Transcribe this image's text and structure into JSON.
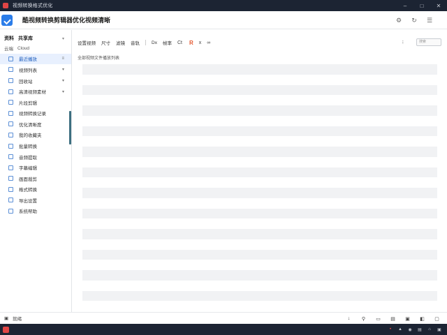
{
  "window": {
    "title": "视频转换格式优化",
    "controls": [
      "–",
      "□",
      "✕"
    ]
  },
  "header": {
    "app_title": "酷视频转换剪辑器优化视频清晰",
    "icons": [
      "⚙",
      "↻",
      "☰"
    ]
  },
  "sidebar": {
    "section_key": "资料",
    "section_label": "共享库",
    "sub_key": "云端",
    "sub_label": "Cloud",
    "items": [
      {
        "label": "最近播放",
        "icon": "list-icon",
        "chevron": "≡"
      },
      {
        "label": "视频列表",
        "icon": "list-icon",
        "chevron": "▾"
      },
      {
        "label": "回收站",
        "icon": "list-icon",
        "chevron": "▾"
      },
      {
        "label": "高清视频素材",
        "icon": "list-icon",
        "chevron": "▾"
      },
      {
        "label": "片段剪辑",
        "icon": "list-icon",
        "chevron": ""
      },
      {
        "label": "视频转换记录",
        "icon": "list-icon",
        "chevron": ""
      },
      {
        "label": "优化清晰度",
        "icon": "list-icon",
        "chevron": ""
      },
      {
        "label": "我的收藏夹",
        "icon": "list-icon",
        "chevron": ""
      },
      {
        "label": "批量转换",
        "icon": "list-icon",
        "chevron": ""
      },
      {
        "label": "音频提取",
        "icon": "list-icon",
        "chevron": ""
      },
      {
        "label": "字幕编辑",
        "icon": "list-icon",
        "chevron": ""
      },
      {
        "label": "画面裁剪",
        "icon": "list-icon",
        "chevron": ""
      },
      {
        "label": "格式转换",
        "icon": "list-icon",
        "chevron": ""
      },
      {
        "label": "导出设置",
        "icon": "list-icon",
        "chevron": ""
      },
      {
        "label": "系统帮助",
        "icon": "list-icon",
        "chevron": ""
      }
    ],
    "active_index": 0
  },
  "toolbar": {
    "items": [
      "设置视频",
      "尺寸",
      "滤镜",
      "音轨",
      "Dx",
      "帧率"
    ],
    "symbol_a": "Ct",
    "symbol_red": "R",
    "symbol_x": "x",
    "symbol_more": "∞",
    "right_dot": "⁝",
    "search_placeholder": "搜索"
  },
  "content": {
    "label": "全部视频文件播放列表",
    "row_count": 24
  },
  "statusbar": {
    "left_icon": "save-icon",
    "left_text": "就绪",
    "right_icons": [
      "↓",
      "⚲",
      "▭",
      "▤",
      "▣",
      "◧",
      "▢"
    ]
  },
  "taskbar": {
    "tray": [
      "•",
      "▲",
      "◉",
      "▤",
      "⌂",
      "▣"
    ]
  }
}
